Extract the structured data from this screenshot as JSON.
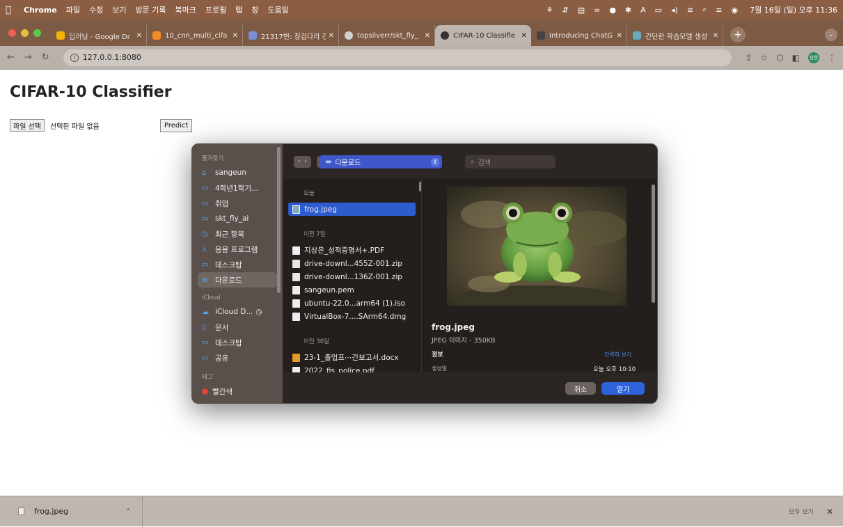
{
  "menubar": {
    "app": "Chrome",
    "items": [
      "파일",
      "수정",
      "보기",
      "방문 기록",
      "북마크",
      "프로필",
      "탭",
      "창",
      "도움말"
    ],
    "clock": "7월 16일 (일) 오후 11:36"
  },
  "tabs": [
    {
      "title": "딥러닝 - Google Dr",
      "color": "#f4b400"
    },
    {
      "title": "10_cnn_multi_cifa",
      "color": "#f28c28"
    },
    {
      "title": "21317번: 징검다리 건",
      "color": "#7b8fd8"
    },
    {
      "title": "topsilverr/skt_fly_",
      "color": "#d0d0d0"
    },
    {
      "title": "CIFAR-10 Classifie",
      "color": "#555555",
      "active": true
    },
    {
      "title": "Introducing ChatG",
      "color": "#444444"
    },
    {
      "title": "간단한 학습모델 생성",
      "color": "#6ab"
    }
  ],
  "toolbar": {
    "url": "127.0.0.1:8080",
    "profile": "상은"
  },
  "page": {
    "title": "CIFAR-10 Classifier",
    "file_button": "파일 선택",
    "no_file": "선택된 파일 없음",
    "predict": "Predict"
  },
  "dialog": {
    "sidebar": {
      "favorites_label": "즐겨찾기",
      "favorites": [
        {
          "label": "sangeun",
          "icon": "⌂"
        },
        {
          "label": "4학년1학기...",
          "icon": "▭"
        },
        {
          "label": "취업",
          "icon": "▭"
        },
        {
          "label": "skt_fly_ai",
          "icon": "▭"
        },
        {
          "label": "최근 항목",
          "icon": "◷"
        },
        {
          "label": "응용 프로그램",
          "icon": "⋏"
        },
        {
          "label": "데스크탑",
          "icon": "▭"
        },
        {
          "label": "다운로드",
          "icon": "⊕",
          "selected": true
        }
      ],
      "icloud_label": "iCloud",
      "icloud": [
        {
          "label": "iCloud D...",
          "icon": "☁"
        },
        {
          "label": "문서",
          "icon": "▯"
        },
        {
          "label": "데스크탑",
          "icon": "▭"
        },
        {
          "label": "공유",
          "icon": "▭"
        }
      ],
      "tags_label": "태그",
      "tags": [
        {
          "label": "빨간색"
        }
      ]
    },
    "location": "다운로드",
    "search_placeholder": "검색",
    "sections": [
      {
        "label": "오늘",
        "files": [
          {
            "name": "frog.jpeg",
            "kind": "img",
            "selected": true
          }
        ]
      },
      {
        "label": "이전 7일",
        "files": [
          {
            "name": "지상은_성적증명서+.PDF",
            "kind": "pdf"
          },
          {
            "name": "drive-downl...455Z-001.zip",
            "kind": "zip"
          },
          {
            "name": "drive-downl...136Z-001.zip",
            "kind": "zip"
          },
          {
            "name": "sangeun.pem",
            "kind": "pdf"
          },
          {
            "name": "ubuntu-22.0...arm64 (1).iso",
            "kind": "pdf"
          },
          {
            "name": "VirtualBox-7....SArm64.dmg",
            "kind": "pdf"
          }
        ]
      },
      {
        "label": "이전 30일",
        "files": [
          {
            "name": "23-1_졸업프⋯간보고서.docx",
            "kind": "doc"
          },
          {
            "name": "2022_fis_police.pdf",
            "kind": "pdf"
          }
        ]
      }
    ],
    "preview": {
      "name": "frog.jpeg",
      "kind": "JPEG 이미지 - 350KB",
      "info": "정보",
      "more": "간략히 보기",
      "created_label": "생성일",
      "created_value": "오늘 오후 10:10"
    },
    "cancel": "취소",
    "open": "열기"
  },
  "downloads": {
    "file": "frog.jpeg",
    "show_all": "모두 보기"
  }
}
